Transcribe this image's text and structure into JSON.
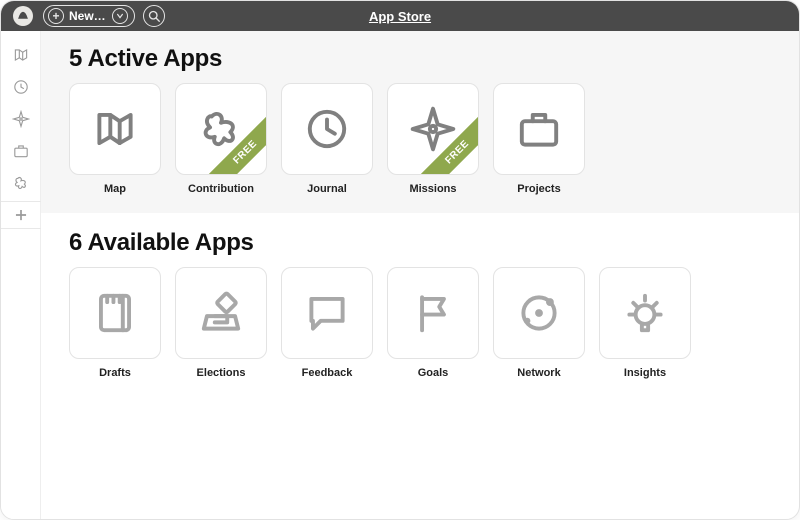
{
  "titlebar": {
    "app_title": "App Store",
    "new_label": "New…"
  },
  "sidebar": {
    "items": [
      {
        "name": "map",
        "icon": "map"
      },
      {
        "name": "journal",
        "icon": "clock"
      },
      {
        "name": "missions",
        "icon": "compass"
      },
      {
        "name": "projects",
        "icon": "briefcase"
      },
      {
        "name": "contribution",
        "icon": "puzzle"
      },
      {
        "name": "app-store",
        "icon": "plus",
        "selected": true
      }
    ]
  },
  "sections": {
    "active": {
      "heading": "5 Active Apps",
      "apps": [
        {
          "label": "Map",
          "icon": "map",
          "free": false
        },
        {
          "label": "Contribution",
          "icon": "puzzle",
          "free": true
        },
        {
          "label": "Journal",
          "icon": "clock",
          "free": false
        },
        {
          "label": "Missions",
          "icon": "compass",
          "free": true
        },
        {
          "label": "Projects",
          "icon": "briefcase",
          "free": false
        }
      ]
    },
    "available": {
      "heading": "6 Available Apps",
      "apps": [
        {
          "label": "Drafts",
          "icon": "notebook"
        },
        {
          "label": "Elections",
          "icon": "ballot"
        },
        {
          "label": "Feedback",
          "icon": "chat"
        },
        {
          "label": "Goals",
          "icon": "flag"
        },
        {
          "label": "Network",
          "icon": "orbit"
        },
        {
          "label": "Insights",
          "icon": "bulb"
        }
      ]
    }
  },
  "badges": {
    "free_label": "FREE"
  }
}
